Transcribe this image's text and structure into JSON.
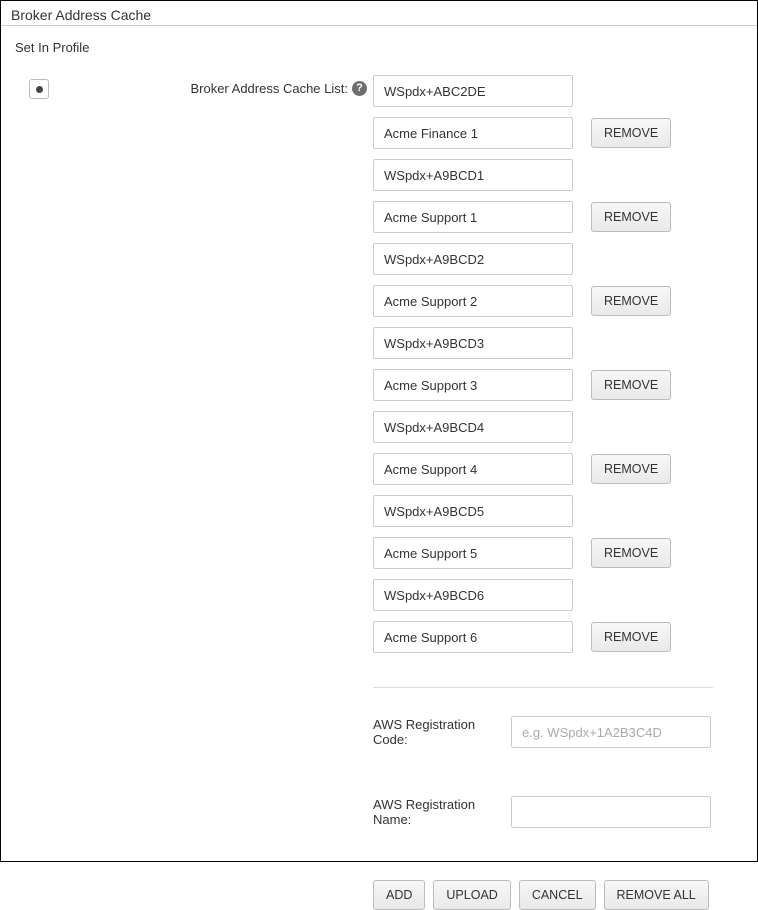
{
  "panel": {
    "title": "Broker Address Cache",
    "subtitle": "Set In Profile"
  },
  "list_label": "Broker Address Cache List:",
  "remove_label": "REMOVE",
  "entries": [
    {
      "value": "WSpdx+ABC2DE",
      "removable": false
    },
    {
      "value": "Acme Finance 1",
      "removable": true
    },
    {
      "value": "WSpdx+A9BCD1",
      "removable": false
    },
    {
      "value": "Acme Support 1",
      "removable": true
    },
    {
      "value": "WSpdx+A9BCD2",
      "removable": false
    },
    {
      "value": "Acme Support 2",
      "removable": true
    },
    {
      "value": "WSpdx+A9BCD3",
      "removable": false
    },
    {
      "value": "Acme Support 3",
      "removable": true
    },
    {
      "value": "WSpdx+A9BCD4",
      "removable": false
    },
    {
      "value": "Acme Support 4",
      "removable": true
    },
    {
      "value": "WSpdx+A9BCD5",
      "removable": false
    },
    {
      "value": "Acme Support 5",
      "removable": true
    },
    {
      "value": "WSpdx+A9BCD6",
      "removable": false
    },
    {
      "value": "Acme Support 6",
      "removable": true
    }
  ],
  "reg_code": {
    "label": "AWS Registration Code:",
    "placeholder": "e.g. WSpdx+1A2B3C4D",
    "value": ""
  },
  "reg_name": {
    "label": "AWS Registration Name:",
    "value": ""
  },
  "buttons": {
    "add": "ADD",
    "upload": "UPLOAD",
    "cancel": "CANCEL",
    "remove_all": "REMOVE ALL"
  }
}
